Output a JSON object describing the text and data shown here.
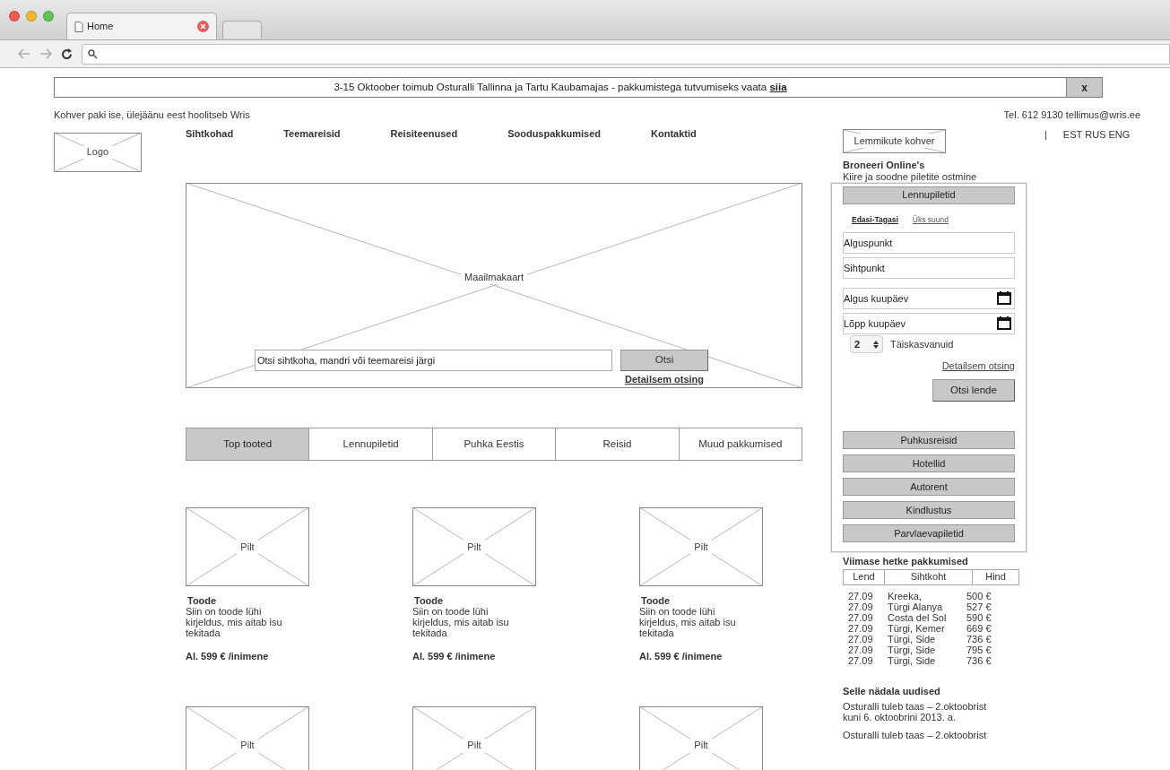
{
  "browser": {
    "tab_title": "Home"
  },
  "announcement": {
    "text": "3-15 Oktoober toimub Osturalli Tallinna ja Tartu Kaubamajas - pakkumistega tutvumiseks vaata **siia**",
    "close": "x"
  },
  "header": {
    "tagline": "Kohver paki ise, ülejäänu eest hoolitseb Wris",
    "contact": "Tel. 612 9130 tellimus@wris.ee",
    "logo": "Logo",
    "lang_separator": "|",
    "languages": [
      "EST",
      "RUS",
      "ENG"
    ],
    "favorites": "Lemmikute kohver"
  },
  "nav": [
    "Sihtkohad",
    "Teemareisid",
    "Reisiteenused",
    "Sooduspakkumised",
    "Kontaktid"
  ],
  "map": {
    "label": "Maailmakaart",
    "search_placeholder": "Otsi sihtkoha, mandri või teemareisi järgi",
    "search_button": "Otsi",
    "advanced_link": "Detailsem otsing"
  },
  "tabs": [
    {
      "label": "Top tooted",
      "selected": true
    },
    {
      "label": "Lennupiletid",
      "selected": false
    },
    {
      "label": "Puhka Eestis",
      "selected": false
    },
    {
      "label": "Reisid",
      "selected": false
    },
    {
      "label": "Muud pakkumised",
      "selected": false
    }
  ],
  "product_rows": [
    [
      {
        "image_label": "Pilt",
        "title": "Toode",
        "description": "Siin on toode lühi kirjeldus, mis aitab isu tekitada",
        "price": "Al. 599 € /inimene"
      },
      {
        "image_label": "Pilt",
        "title": "Toode",
        "description": "Siin on toode lühi kirjeldus, mis aitab isu tekitada",
        "price": "Al. 599 € /inimene"
      },
      {
        "image_label": "Pilt",
        "title": "Toode",
        "description": "Siin on toode lühi kirjeldus, mis aitab isu tekitada",
        "price": "Al. 599 € /inimene"
      }
    ],
    [
      {
        "image_label": "Pilt"
      },
      {
        "image_label": "Pilt"
      },
      {
        "image_label": "Pilt"
      }
    ]
  ],
  "booking": {
    "title": "Broneeri Online's",
    "subtitle": "Kiire ja soodne piletite ostmine",
    "header_button": "Lennupiletid",
    "trip_types": [
      {
        "label": "Edasi-Tagasi",
        "selected": true
      },
      {
        "label": "Üks suund",
        "selected": false
      }
    ],
    "fields": [
      {
        "placeholder": "Alguspunkt",
        "kind": "text"
      },
      {
        "placeholder": "Sihtpunkt",
        "kind": "text"
      },
      {
        "placeholder": "Algus kuupäev",
        "kind": "date"
      },
      {
        "placeholder": "Lõpp kuupäev",
        "kind": "date"
      }
    ],
    "adults": {
      "value": "2",
      "label": "Täiskasvanuid"
    },
    "advanced_link": "Detailsem otsing",
    "search_button": "Otsi lende",
    "categories": [
      "Puhkusreisid",
      "Hotellid",
      "Autorent",
      "Kindlustus",
      "Parvlaevapiletid"
    ]
  },
  "deals": {
    "title": "Viimase hetke pakkumised",
    "columns": [
      "Lend",
      "Sihtkoht",
      "Hind"
    ],
    "rows": [
      [
        "27.09",
        "Kreeka,",
        "500 €"
      ],
      [
        "27.09",
        "Türgi Alanya",
        "527 €"
      ],
      [
        "27.09",
        "Costa del Sol",
        "590 €"
      ],
      [
        "27.09",
        "Türgi, Kemer",
        "669 €"
      ],
      [
        "27.09",
        "Türgi, Side",
        "736 €"
      ],
      [
        "27.09",
        "Türgi, Side",
        "795 €"
      ],
      [
        "27.09",
        "Türgi, Side",
        "736 €"
      ]
    ]
  },
  "news": {
    "title": "Selle nädala uudised",
    "items": [
      "Osturalli tuleb taas – 2.oktoobrist kuni 6. oktoobrini 2013. a.",
      "Osturalli tuleb taas – 2.oktoobrist"
    ]
  }
}
